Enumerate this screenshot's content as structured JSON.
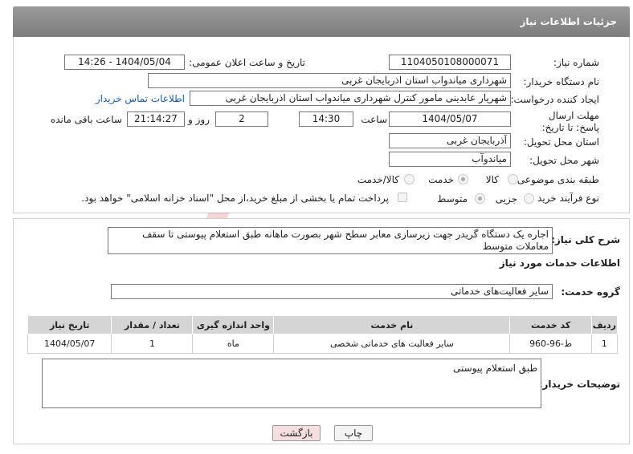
{
  "header": {
    "title": "جزئیات اطلاعات نیاز"
  },
  "fields": {
    "need_number_label": "شماره نیاز:",
    "need_number": "1104050108000071",
    "announce_label": "تاریخ و ساعت اعلان عمومی:",
    "announce_value": "1404/05/04 - 14:26",
    "buyer_org_label": "نام دستگاه خریدار:",
    "buyer_org": "شهرداری میاندواب استان اذربایجان غربی",
    "creator_label": "ایجاد کننده درخواست:",
    "creator": "شهریار  عابدینی مامور کنترل شهرداری میاندواب استان اذربایجان غربی",
    "contact_link": "اطلاعات تماس خریدار",
    "deadline_label": "مهلت ارسال پاسخ: تا تاریخ:",
    "deadline_date": "1404/05/07",
    "time_label": "ساعت",
    "deadline_time": "14:30",
    "days_value": "2",
    "days_label": "روز و",
    "remaining_time": "21:14:27",
    "remaining_label": "ساعت باقی مانده",
    "province_label": "استان محل تحویل:",
    "province": "آذربایجان غربی",
    "city_label": "شهر محل تحویل:",
    "city": "میاندوآب",
    "category_label": "طبقه بندی موضوعی:",
    "category_options": [
      "کالا",
      "خدمت",
      "کالا/خدمت"
    ],
    "category_selected": "خدمت",
    "process_label": "نوع فرآیند خرید :",
    "process_options": [
      "جزیی",
      "متوسط"
    ],
    "process_selected": "متوسط",
    "payment_note": "پرداخت تمام یا بخشی از مبلغ خرید،از محل \"اسناد خزانه اسلامی\" خواهد بود."
  },
  "summary": {
    "label": "شرح کلی نیاز:",
    "text": "اجاره یک دستگاه گریدر جهت زیرسازی معابر سطح شهر بصورت ماهانه طبق استعلام پیوستی تا سقف معاملات متوسط"
  },
  "services": {
    "section_title": "اطلاعات خدمات مورد نیاز",
    "group_label": "گروه خدمت:",
    "group_value": "سایر فعالیت‌های خدماتی",
    "columns": [
      "ردیف",
      "کد خدمت",
      "نام خدمت",
      "واحد اندازه گیری",
      "تعداد / مقدار",
      "تاریخ نیاز"
    ],
    "rows": [
      {
        "row": "1",
        "code": "ط-96-960",
        "name": "سایر فعالیت های خدماتی شخصی",
        "unit": "ماه",
        "qty": "1",
        "date": "1404/05/07"
      }
    ]
  },
  "buyer_notes": {
    "label": "توضیحات خریدار:",
    "text": "طبق استعلام پیوستی"
  },
  "buttons": {
    "print": "چاپ",
    "back": "بازگشت"
  },
  "watermark": {
    "text": "AriaTender.neT"
  },
  "colors": {
    "header": "#8a8a8a",
    "link": "#1a5eb0",
    "back_button": "#f5dede",
    "watermark": "#e8a0a0"
  }
}
